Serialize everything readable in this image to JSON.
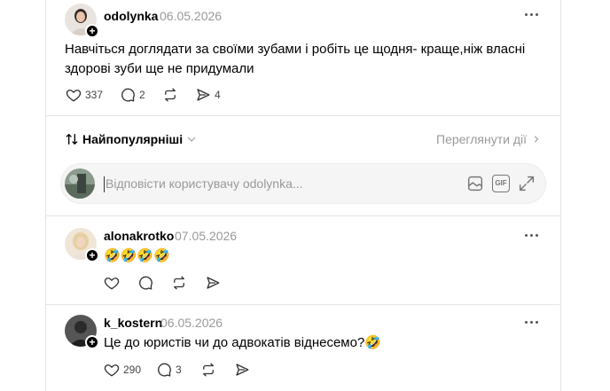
{
  "post": {
    "username": "odolynka",
    "date": "06.05.2026",
    "text": "Навчіться доглядати за своїми зубами і робіть це щодня- краще,ніж власні здорові зуби ще не придумали",
    "likes": "337",
    "comments": "2",
    "shares": "4"
  },
  "sort": {
    "label": "Найпопулярніші",
    "view_activity": "Переглянути дії"
  },
  "reply": {
    "placeholder": "Відповісти користувачу odolynka...",
    "gif_label": "GIF"
  },
  "comments": [
    {
      "username": "alonakrotko",
      "date": "07.05.2026",
      "text": "🤣🤣🤣🤣",
      "likes": "",
      "replies": ""
    },
    {
      "username": "k_kostern",
      "date": "06.05.2026",
      "text": "Це до юристів чи до адвокатів віднесемо?🤣",
      "likes": "290",
      "replies": "3"
    }
  ]
}
